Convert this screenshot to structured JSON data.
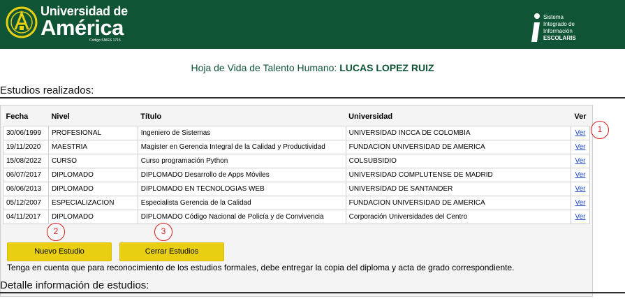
{
  "header": {
    "logo_line1": "Universidad de",
    "logo_line2": "América",
    "logo_code": "Código SNIES 1715",
    "system_lines": [
      "Sistema",
      "Integrado de",
      "Información"
    ],
    "system_name": "ESCOLARIS"
  },
  "page_title": {
    "prefix": "Hoja de Vida de Talento Humano: ",
    "name": "LUCAS LOPEZ RUIZ"
  },
  "sections": {
    "studies": "Estudios realizados:",
    "details": "Detalle información de estudios:"
  },
  "table": {
    "headers": [
      "Fecha",
      "Nivel",
      "Título",
      "Universidad",
      "Ver"
    ],
    "link_label": "Ver",
    "rows": [
      [
        "30/06/1999",
        "PROFESIONAL",
        "Ingeniero de Sistemas",
        "UNIVERSIDAD INCCA DE COLOMBIA"
      ],
      [
        "19/11/2020",
        "MAESTRIA",
        "Magister en Gerencia Integral de la Calidad y Productividad",
        "FUNDACION UNIVERSIDAD DE AMERICA"
      ],
      [
        "15/08/2022",
        "CURSO",
        "Curso programación Python",
        "COLSUBSIDIO"
      ],
      [
        "06/07/2017",
        "DIPLOMADO",
        "DIPLOMADO Desarrollo de Apps Móviles",
        "UNIVERSIDAD COMPLUTENSE DE MADRID"
      ],
      [
        "06/06/2013",
        "DIPLOMADO",
        "DIPLOMADO EN TECNOLOGIAS WEB",
        "UNIVERSIDAD DE SANTANDER"
      ],
      [
        "05/12/2007",
        "ESPECIALIZACION",
        "Especialista Gerencia de la Calidad",
        "FUNDACION UNIVERSIDAD DE AMERICA"
      ],
      [
        "04/11/2017",
        "DIPLOMADO",
        "DIPLOMADO Código Nacional de Policía y de Convivencia",
        "Corporación Universidades del Centro"
      ]
    ]
  },
  "buttons": {
    "new_study": "Nuevo Estudio",
    "close_studies": "Cerrar Estudios"
  },
  "note": "Tenga en cuenta que para reconocimiento de los estudios formales, debe entregar la copia del diploma y acta de grado correspondiente.",
  "markers": [
    "1",
    "2",
    "3"
  ],
  "colors": {
    "brand_green": "#0f5434",
    "button_yellow": "#e8cf12",
    "link_blue": "#1a44c2",
    "marker_red": "#d81e1e"
  }
}
